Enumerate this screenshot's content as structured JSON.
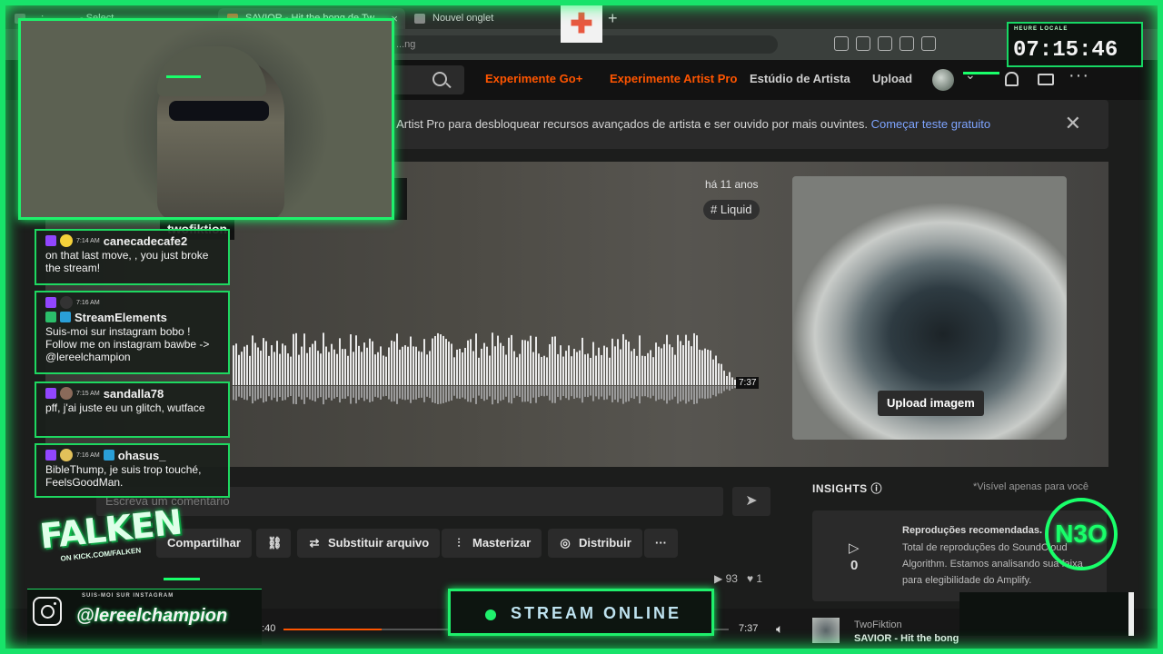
{
  "browser": {
    "tabs": [
      {
        "label": "...: ...  ...   ... - Select",
        "active": false
      },
      {
        "label": "SAVIOR - Hit the bong de Tw",
        "active": true
      },
      {
        "label": "Nouvel onglet",
        "active": false
      }
    ],
    "url": "...ng"
  },
  "header": {
    "nav": [
      {
        "label": "Experimente Go+",
        "style": "orange"
      },
      {
        "label": "Experimente Artist Pro",
        "style": "orange"
      },
      {
        "label": "Estúdio de Artista",
        "style": "grey"
      },
      {
        "label": "Upload",
        "style": "grey"
      }
    ]
  },
  "banner": {
    "text": "o Artist Pro para desbloquear recursos avançados de artista e ser ouvido por mais ouvintes.",
    "link": "Começar teste gratuito"
  },
  "track": {
    "artist": "twofiktion",
    "title_fragment": "g",
    "age": "há 11 anos",
    "tag": "# Liquid",
    "duration": "7:37",
    "upload_image": "Upload imagem"
  },
  "comment": {
    "placeholder": "Escreva um comentário"
  },
  "actions": [
    {
      "label": "Compartilhar",
      "icon": "share-icon"
    },
    {
      "label": "",
      "icon": "link-icon"
    },
    {
      "label": "Substituir arquivo",
      "icon": "replace-icon"
    },
    {
      "label": "Masterizar",
      "icon": "sliders-icon"
    },
    {
      "label": "Distribuir",
      "icon": "globe-icon"
    },
    {
      "label": "···",
      "icon": "more-icon"
    }
  ],
  "stats": {
    "plays": "93",
    "likes": "1"
  },
  "insights": {
    "title": "INSIGHTS",
    "note": "*Visível apenas para você",
    "count": "0",
    "card_title": "Reproduções recomendadas.",
    "card_body": "Total de reproduções do SoundCloud Algorithm. Estamos analisando sua faixa para elegibilidade do Amplify."
  },
  "player": {
    "current": "1:40",
    "total": "7:37",
    "progress": 0.22,
    "now_playing_artist": "TwoFiktion",
    "now_playing_title": "SAVIOR - Hit the bong"
  },
  "clock": {
    "label": "HEURE LOCALE",
    "time": "07:15:46"
  },
  "chat": [
    {
      "time": "7:14 AM",
      "user": "canecadecafe2",
      "text": "on that last move, , you just broke the stream!"
    },
    {
      "time": "7:16 AM",
      "user": "StreamElements",
      "text": "Suis-moi sur instagram bobo ! Follow me on instagram bawbe -> @lereelchampion"
    },
    {
      "time": "7:15 AM",
      "user": "sandalla78",
      "text": "pff, j'ai juste eu un glitch, wutface"
    },
    {
      "time": "7:16 AM",
      "user": "ohasus_",
      "text": "BibleThump, je suis trop touché, FeelsGoodMan."
    }
  ],
  "overlay": {
    "brand": "FALKEN",
    "brand_sub": "ON KICK.COM/FALKEN",
    "insta_top": "SUIS-MOI SUR INSTAGRAM",
    "insta_handle": "@lereelchampion",
    "stream_status": "STREAM ONLINE",
    "neo_logo": "N3O"
  },
  "colors": {
    "neon": "#19ff6a",
    "soundcloud_orange": "#ff5500",
    "link": "#7ea4ff"
  }
}
